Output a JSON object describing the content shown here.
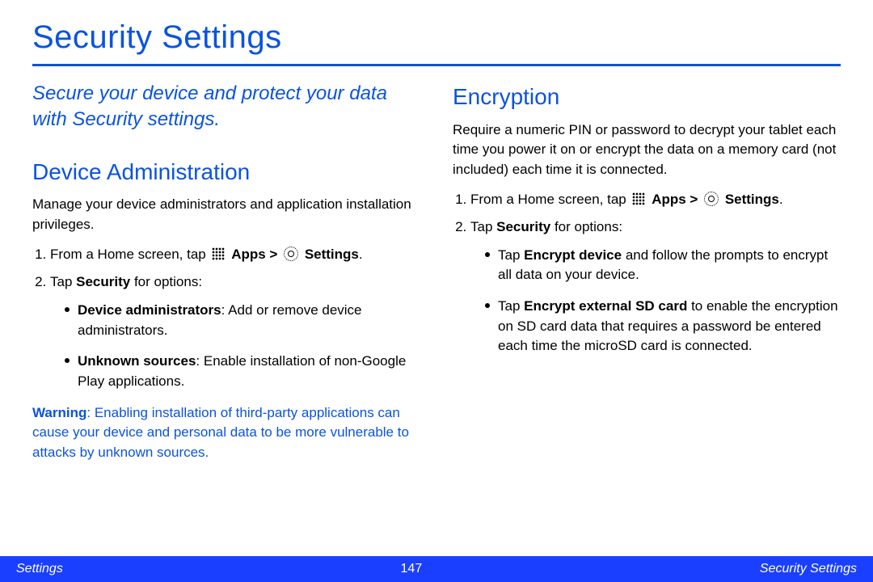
{
  "title": "Security Settings",
  "intro": "Secure your device and protect your data with Security settings.",
  "deviceAdmin": {
    "heading": "Device Administration",
    "body": "Manage your device administrators and application installation privileges.",
    "step1_a": "From a Home screen, tap ",
    "step1_apps": "Apps > ",
    "step1_settings": "Settings",
    "step1_end": ".",
    "step2_a": "Tap ",
    "step2_b": "Security",
    "step2_c": " for options:",
    "bullet1_b": "Device administrators",
    "bullet1_rest": ": Add or remove device administrators.",
    "bullet2_b": "Unknown sources",
    "bullet2_rest": ": Enable installation of non-Google Play applications.",
    "warn_b": "Warning",
    "warn_rest": ": Enabling installation of third-party applications can cause your device and personal data to be more vulnerable to attacks by unknown sources."
  },
  "encryption": {
    "heading": "Encryption",
    "body": "Require a numeric PIN or password to decrypt your tablet each time you power it on or encrypt the data on a memory card (not included) each time it is connected.",
    "step1_a": "From a Home screen, tap ",
    "step1_apps": "Apps > ",
    "step1_settings": "Settings",
    "step1_end": ".",
    "step2_a": "Tap ",
    "step2_b": "Security",
    "step2_c": " for options:",
    "bullet1_pre": "Tap ",
    "bullet1_b": "Encrypt device",
    "bullet1_rest": " and follow the prompts to encrypt all data on your device.",
    "bullet2_pre": "Tap ",
    "bullet2_b": "Encrypt external SD card",
    "bullet2_rest": " to enable the encryption on SD card data that requires a password be entered each time the microSD card is connected."
  },
  "footer": {
    "left": "Settings",
    "page": "147",
    "right": "Security Settings"
  }
}
